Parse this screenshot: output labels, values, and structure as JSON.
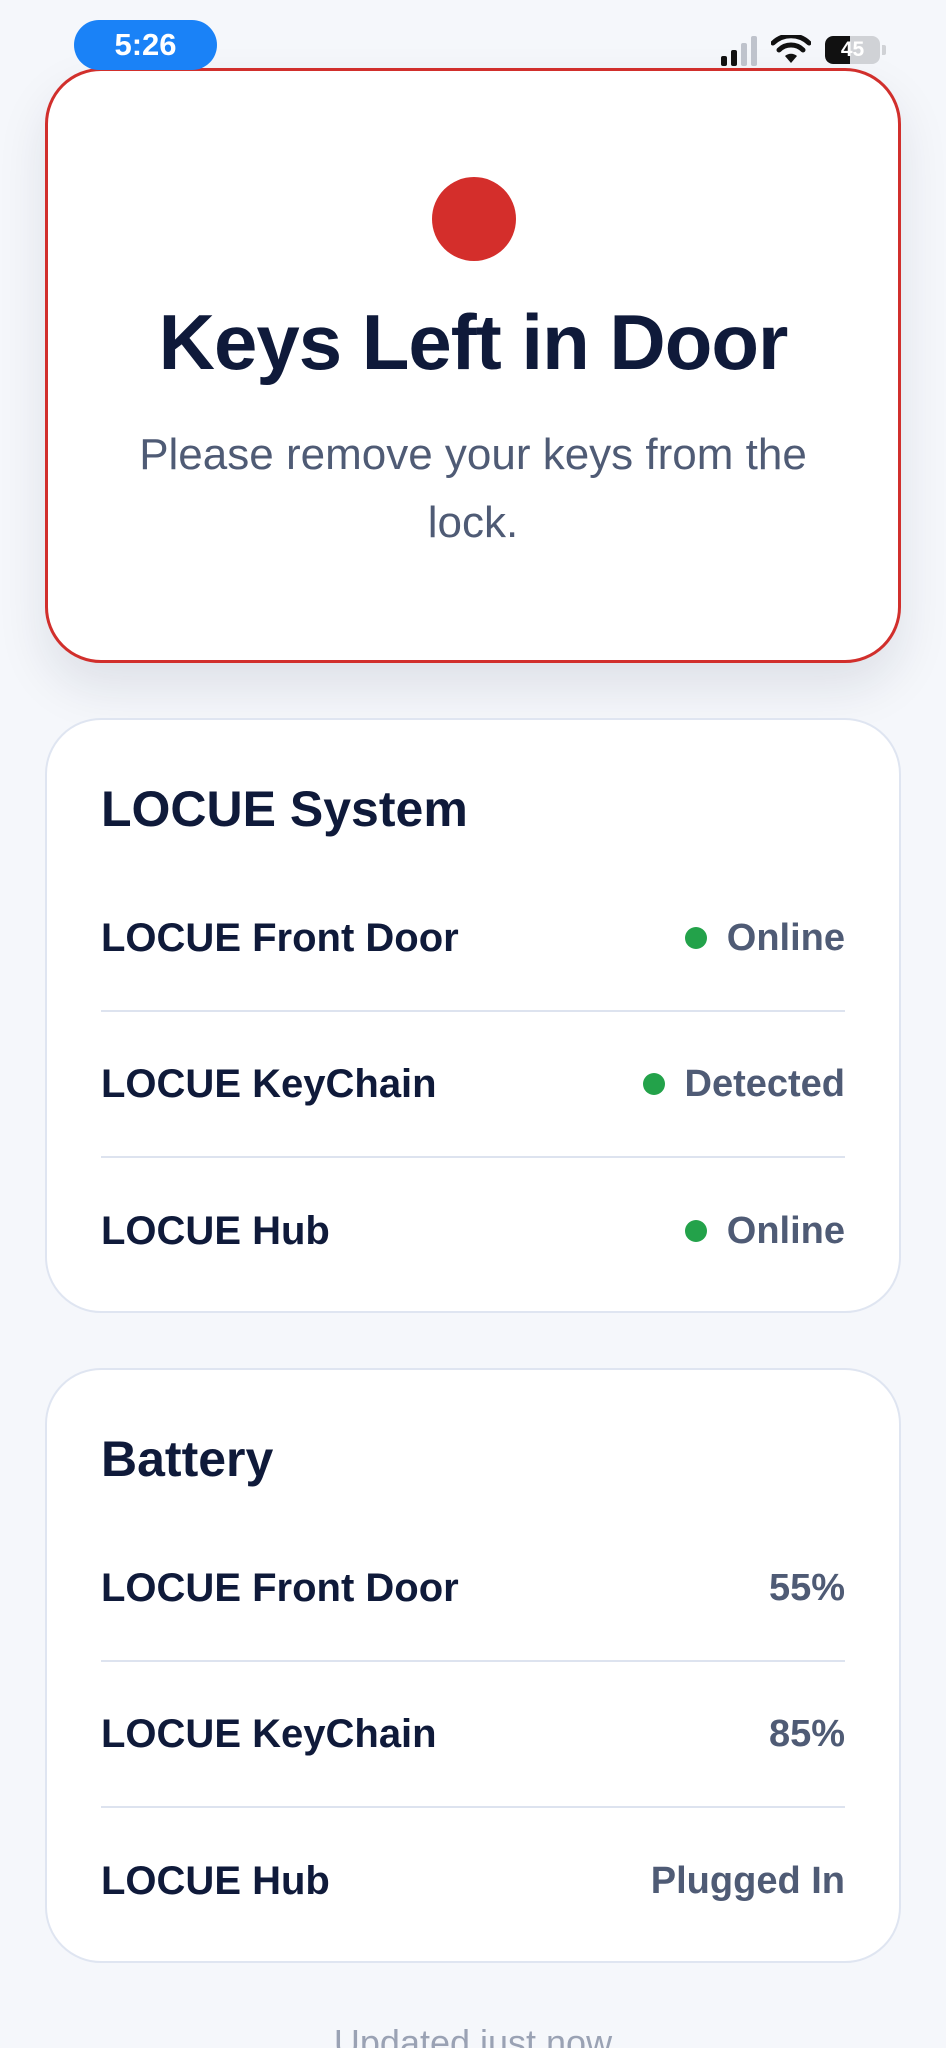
{
  "status_bar": {
    "time": "5:26",
    "battery_level": "45",
    "battery_fraction": 0.45
  },
  "alert": {
    "title": "Keys Left in Door",
    "message": "Please remove your keys from the lock.",
    "accent_color": "#d42e2b"
  },
  "system": {
    "title": "LOCUE System",
    "rows": [
      {
        "name": "LOCUE Front Door",
        "status": "Online"
      },
      {
        "name": "LOCUE KeyChain",
        "status": "Detected"
      },
      {
        "name": "LOCUE Hub",
        "status": "Online"
      }
    ],
    "status_dot_color": "#23a24a"
  },
  "battery": {
    "title": "Battery",
    "rows": [
      {
        "name": "LOCUE Front Door",
        "value": "55%"
      },
      {
        "name": "LOCUE KeyChain",
        "value": "85%"
      },
      {
        "name": "LOCUE Hub",
        "value": "Plugged In"
      }
    ]
  },
  "footer": {
    "text": "Updated just now"
  }
}
